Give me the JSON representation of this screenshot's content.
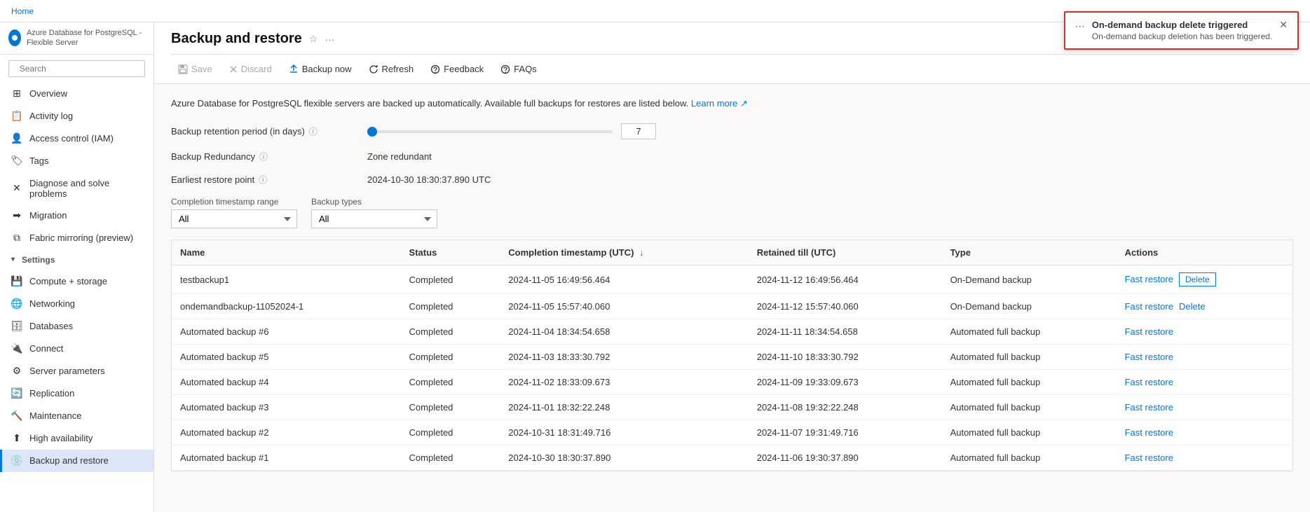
{
  "topbar": {
    "home": "Home"
  },
  "sidebar": {
    "logo_text_line1": "Azure Database for PostgreSQL - Flexible Server",
    "search_placeholder": "Search",
    "nav_items": [
      {
        "id": "overview",
        "label": "Overview",
        "icon": "⊞"
      },
      {
        "id": "activity-log",
        "label": "Activity log",
        "icon": "📋"
      },
      {
        "id": "access-control",
        "label": "Access control (IAM)",
        "icon": "👤"
      },
      {
        "id": "tags",
        "label": "Tags",
        "icon": "🏷"
      },
      {
        "id": "diagnose",
        "label": "Diagnose and solve problems",
        "icon": "🔧"
      },
      {
        "id": "migration",
        "label": "Migration",
        "icon": "➡"
      },
      {
        "id": "fabric-mirroring",
        "label": "Fabric mirroring (preview)",
        "icon": "🪞"
      }
    ],
    "settings_label": "Settings",
    "settings_items": [
      {
        "id": "compute-storage",
        "label": "Compute + storage",
        "icon": "💾"
      },
      {
        "id": "networking",
        "label": "Networking",
        "icon": "🌐"
      },
      {
        "id": "databases",
        "label": "Databases",
        "icon": "🗄"
      },
      {
        "id": "connect",
        "label": "Connect",
        "icon": "🔌"
      },
      {
        "id": "server-parameters",
        "label": "Server parameters",
        "icon": "⚙"
      },
      {
        "id": "replication",
        "label": "Replication",
        "icon": "🔄"
      },
      {
        "id": "maintenance",
        "label": "Maintenance",
        "icon": "🔨"
      },
      {
        "id": "high-availability",
        "label": "High availability",
        "icon": "⬆"
      },
      {
        "id": "backup-restore",
        "label": "Backup and restore",
        "icon": "💿"
      }
    ]
  },
  "page": {
    "title": "Backup and restore",
    "subtitle": "Azure Database for PostgreSQL - Flexible Server",
    "description": "Azure Database for PostgreSQL flexible servers are backed up automatically. Available full backups for restores are listed below.",
    "learn_more": "Learn more",
    "toolbar": {
      "save": "Save",
      "discard": "Discard",
      "backup_now": "Backup now",
      "refresh": "Refresh",
      "feedback": "Feedback",
      "faqs": "FAQs"
    },
    "form": {
      "retention_label": "Backup retention period (in days)",
      "retention_value": "7",
      "redundancy_label": "Backup Redundancy",
      "redundancy_value": "Zone redundant",
      "restore_point_label": "Earliest restore point",
      "restore_point_value": "2024-10-30 18:30:37.890 UTC"
    },
    "filters": {
      "timestamp_label": "Completion timestamp range",
      "timestamp_default": "All",
      "type_label": "Backup types",
      "type_default": "All"
    },
    "table": {
      "columns": [
        {
          "id": "name",
          "label": "Name"
        },
        {
          "id": "status",
          "label": "Status"
        },
        {
          "id": "completion-ts",
          "label": "Completion timestamp (UTC)",
          "sortable": true
        },
        {
          "id": "retained-till",
          "label": "Retained till (UTC)"
        },
        {
          "id": "type",
          "label": "Type"
        },
        {
          "id": "actions",
          "label": "Actions"
        }
      ],
      "rows": [
        {
          "name": "testbackup1",
          "status": "Completed",
          "completion_ts": "2024-11-05 16:49:56.464",
          "retained_till": "2024-11-12 16:49:56.464",
          "type": "On-Demand backup",
          "actions": [
            "Fast restore",
            "Delete"
          ],
          "has_delete_outlined": true
        },
        {
          "name": "ondemandbackup-11052024-1",
          "status": "Completed",
          "completion_ts": "2024-11-05 15:57:40.060",
          "retained_till": "2024-11-12 15:57:40.060",
          "type": "On-Demand backup",
          "actions": [
            "Fast restore",
            "Delete"
          ],
          "has_delete_outlined": false
        },
        {
          "name": "Automated backup #6",
          "status": "Completed",
          "completion_ts": "2024-11-04 18:34:54.658",
          "retained_till": "2024-11-11 18:34:54.658",
          "type": "Automated full backup",
          "actions": [
            "Fast restore"
          ],
          "has_delete_outlined": false
        },
        {
          "name": "Automated backup #5",
          "status": "Completed",
          "completion_ts": "2024-11-03 18:33:30.792",
          "retained_till": "2024-11-10 18:33:30.792",
          "type": "Automated full backup",
          "actions": [
            "Fast restore"
          ],
          "has_delete_outlined": false
        },
        {
          "name": "Automated backup #4",
          "status": "Completed",
          "completion_ts": "2024-11-02 18:33:09.673",
          "retained_till": "2024-11-09 19:33:09.673",
          "type": "Automated full backup",
          "actions": [
            "Fast restore"
          ],
          "has_delete_outlined": false
        },
        {
          "name": "Automated backup #3",
          "status": "Completed",
          "completion_ts": "2024-11-01 18:32:22.248",
          "retained_till": "2024-11-08 19:32:22.248",
          "type": "Automated full backup",
          "actions": [
            "Fast restore"
          ],
          "has_delete_outlined": false
        },
        {
          "name": "Automated backup #2",
          "status": "Completed",
          "completion_ts": "2024-10-31 18:31:49.716",
          "retained_till": "2024-11-07 19:31:49.716",
          "type": "Automated full backup",
          "actions": [
            "Fast restore"
          ],
          "has_delete_outlined": false
        },
        {
          "name": "Automated backup #1",
          "status": "Completed",
          "completion_ts": "2024-10-30 18:30:37.890",
          "retained_till": "2024-11-06 19:30:37.890",
          "type": "Automated full backup",
          "actions": [
            "Fast restore"
          ],
          "has_delete_outlined": false
        }
      ]
    }
  },
  "notification": {
    "title": "On-demand backup delete triggered",
    "message": "On-demand backup deletion has been triggered.",
    "icon": "⋯"
  }
}
